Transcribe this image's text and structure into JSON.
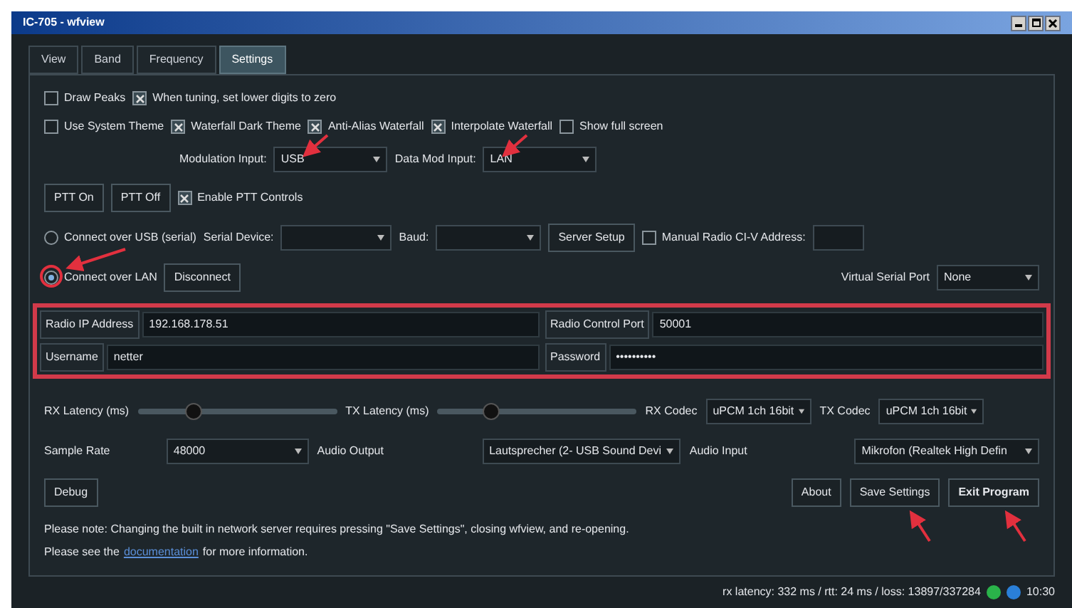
{
  "window": {
    "title": "IC-705 - wfview"
  },
  "tabs": [
    {
      "label": "View",
      "selected": false
    },
    {
      "label": "Band",
      "selected": false
    },
    {
      "label": "Frequency",
      "selected": false
    },
    {
      "label": "Settings",
      "selected": true
    }
  ],
  "settings_rows": [
    [
      {
        "kind": "checkbox",
        "label": "Draw Peaks",
        "checked": false
      },
      {
        "kind": "checkbox",
        "label": "When tuning, set lower digits to zero",
        "checked": true
      }
    ],
    [
      {
        "kind": "checkbox",
        "label": "Use System Theme",
        "checked": false
      },
      {
        "kind": "checkbox",
        "label": "Waterfall Dark Theme",
        "checked": true
      },
      {
        "kind": "checkbox",
        "label": "Anti-Alias Waterfall",
        "checked": true
      },
      {
        "kind": "checkbox",
        "label": "Interpolate Waterfall",
        "checked": true
      },
      {
        "kind": "checkbox",
        "label": "Show full screen",
        "checked": false
      }
    ],
    [
      {
        "kind": "spacer"
      },
      {
        "kind": "label",
        "label": "Modulation Input:"
      },
      {
        "kind": "dropdown",
        "value": "USB"
      },
      {
        "kind": "label",
        "label": "Data Mod Input:"
      },
      {
        "kind": "dropdown",
        "value": "LAN"
      }
    ],
    [
      {
        "kind": "button",
        "label": "PTT On"
      },
      {
        "kind": "button",
        "label": "PTT Off"
      },
      {
        "kind": "checkbox",
        "label": "Enable PTT Controls",
        "checked": true
      }
    ],
    [
      {
        "kind": "radio",
        "label": "Connect over USB (serial)",
        "selected": false
      },
      {
        "kind": "label",
        "label": "Serial Device:"
      },
      {
        "kind": "dropdown"
      },
      {
        "kind": "label",
        "label": "Baud:"
      },
      {
        "kind": "dropdown"
      },
      {
        "kind": "button",
        "label": "Server Setup"
      },
      {
        "kind": "checkbox",
        "label": "Manual Radio CI-V Address:",
        "checked": false
      },
      {
        "kind": "field"
      }
    ],
    [
      {
        "kind": "radio",
        "label": "Connect over LAN",
        "selected": true
      },
      {
        "kind": "button",
        "label": "Disconnect"
      },
      {
        "kind": "grow"
      },
      {
        "kind": "label",
        "label": "Virtual Serial Port"
      },
      {
        "kind": "dropdown",
        "value": "None"
      }
    ]
  ],
  "network": [
    [
      {
        "label": "Radio IP Address",
        "value": "192.168.178.51"
      },
      {
        "label": "Radio Control Port",
        "value": "50001"
      }
    ],
    [
      {
        "label": "Username",
        "value": "netter"
      },
      {
        "label": "Password",
        "value": "••••••••••"
      }
    ]
  ],
  "audio_rows": [
    [
      {
        "kind": "label",
        "label": "RX Latency (ms)"
      },
      {
        "kind": "slider",
        "level": 0.28
      },
      {
        "kind": "label",
        "label": "TX Latency (ms)"
      },
      {
        "kind": "slider",
        "level": 0.27
      },
      {
        "kind": "label",
        "label": "RX Codec"
      },
      {
        "kind": "dropdown",
        "value": "uPCM 1ch 16bit"
      },
      {
        "kind": "label",
        "label": "TX Codec"
      },
      {
        "kind": "dropdown",
        "value": "uPCM 1ch 16bit"
      }
    ],
    [
      {
        "kind": "label",
        "label": "Sample Rate"
      },
      {
        "kind": "dropdown",
        "value": "48000"
      },
      {
        "kind": "label",
        "label": "Audio Output"
      },
      {
        "kind": "dropdown",
        "value": "Lautsprecher (2- USB Sound Devi"
      },
      {
        "kind": "label",
        "label": "Audio Input"
      },
      {
        "kind": "dropdown",
        "value": "Mikrofon (Realtek High Defin"
      }
    ],
    [
      {
        "kind": "button",
        "label": "Debug"
      },
      {
        "kind": "grow"
      },
      {
        "kind": "button",
        "label": "About"
      },
      {
        "kind": "button",
        "label": "Save Settings"
      },
      {
        "kind": "default_button",
        "label": "Exit Program"
      }
    ]
  ],
  "note": "Please note: Changing the built in network server requires pressing \"Save Settings\", closing wfview, and re-opening.",
  "see": {
    "before": "Please see the",
    "link": "documentation",
    "after": "for more information."
  },
  "status_bar": {
    "text": "rx latency: 332 ms / rtt: 24 ms / loss: 13897/337284",
    "time": "10:30"
  }
}
